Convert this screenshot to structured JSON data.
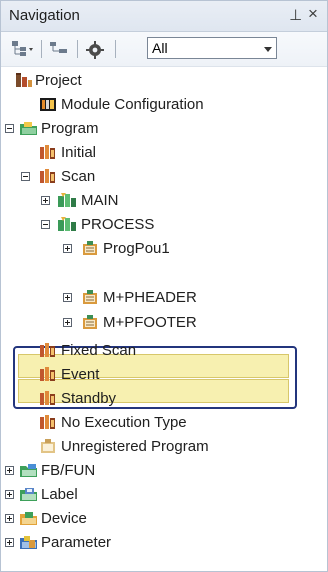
{
  "panel": {
    "title": "Navigation",
    "pin_glyph": "⊥",
    "close_glyph": "×"
  },
  "toolbar": {
    "buttons": [
      {
        "name": "tree-view-dropdown-icon"
      },
      {
        "name": "collapse-tree-icon"
      },
      {
        "name": "gear-icon"
      }
    ],
    "filter": {
      "value": "All"
    }
  },
  "tree": {
    "items": [
      {
        "label": "Project",
        "icon": "project-icon",
        "level": 0
      },
      {
        "label": "Module Configuration",
        "icon": "module-config-icon",
        "level": 1
      },
      {
        "label": "Program",
        "icon": "program-folder-icon",
        "level": 0
      },
      {
        "label": "Initial",
        "icon": "task-icon",
        "level": 1
      },
      {
        "label": "Scan",
        "icon": "task-icon",
        "level": 1
      },
      {
        "label": "MAIN",
        "icon": "program-block-icon",
        "level": 2
      },
      {
        "label": "PROCESS",
        "icon": "program-block-icon",
        "level": 2
      },
      {
        "label": "ProgPou1",
        "icon": "pou-icon",
        "level": 3
      },
      {
        "label": "M+PHEADER",
        "icon": "pou-icon",
        "level": 3
      },
      {
        "label": "M+PFOOTER",
        "icon": "pou-icon",
        "level": 3
      },
      {
        "label": "Fixed Scan",
        "icon": "task-icon",
        "level": 1
      },
      {
        "label": "Event",
        "icon": "task-icon",
        "level": 1
      },
      {
        "label": "Standby",
        "icon": "task-icon",
        "level": 1
      },
      {
        "label": "No Execution Type",
        "icon": "task-icon",
        "level": 1
      },
      {
        "label": "Unregistered Program",
        "icon": "unregistered-icon",
        "level": 1
      },
      {
        "label": "FB/FUN",
        "icon": "fbfun-icon",
        "level": 0
      },
      {
        "label": "Label",
        "icon": "label-icon",
        "level": 0
      },
      {
        "label": "Device",
        "icon": "device-icon",
        "level": 0
      },
      {
        "label": "Parameter",
        "icon": "parameter-icon",
        "level": 0
      }
    ]
  },
  "colors": {
    "highlight_fill": "#f7f0b0",
    "highlight_border": "#23357d"
  }
}
